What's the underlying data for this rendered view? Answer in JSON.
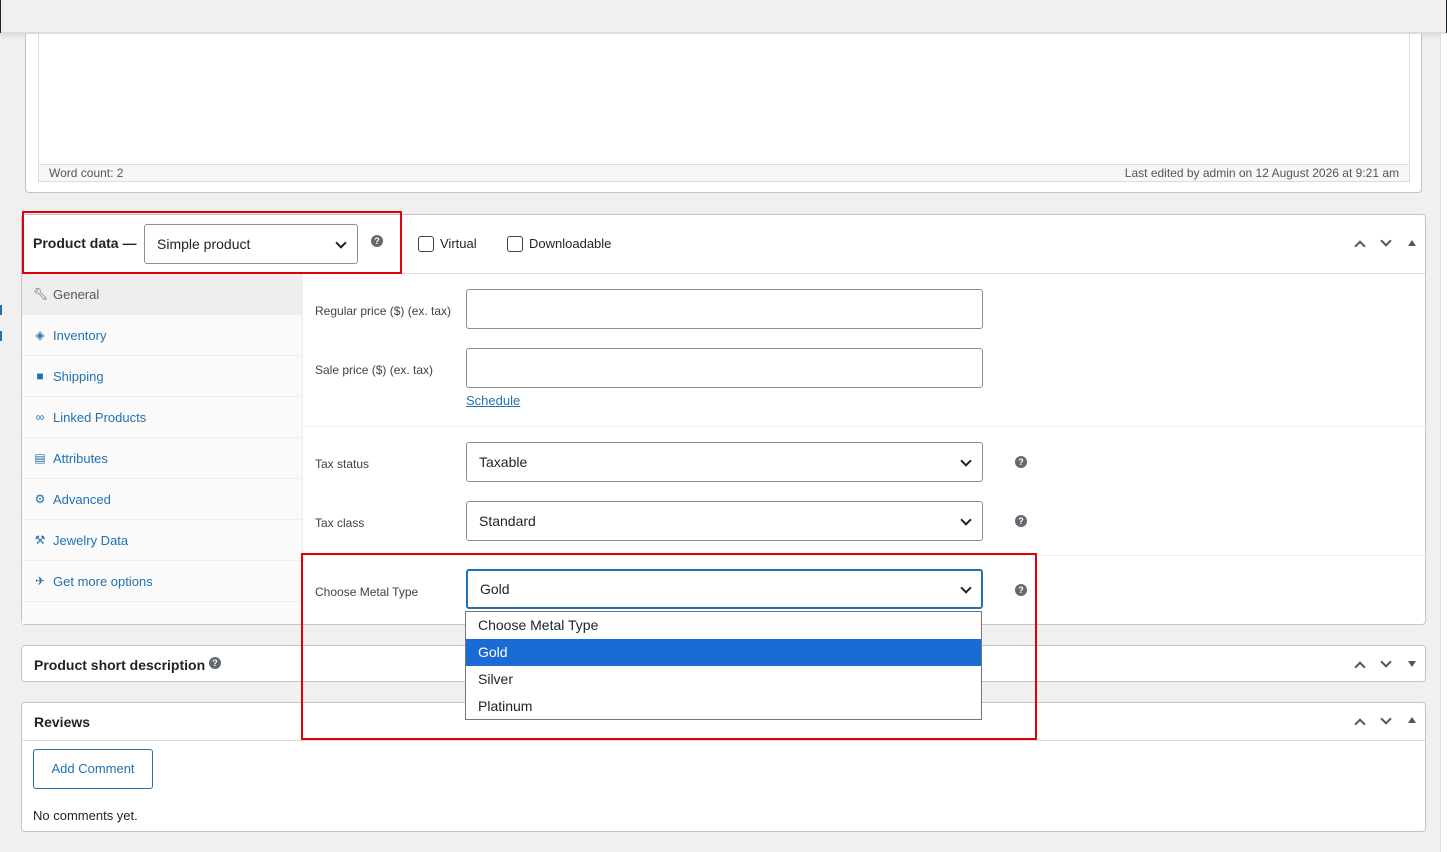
{
  "editor": {
    "word_count": "Word count: 2",
    "last_edited": "Last edited by admin on 12 August 2026 at 9:21 am"
  },
  "product_data": {
    "title": "Product data —",
    "type_selected": "Simple product",
    "virtual_label": "Virtual",
    "downloadable_label": "Downloadable",
    "tabs": [
      {
        "label": "General",
        "icon": "wrench-icon"
      },
      {
        "label": "Inventory",
        "icon": "tag-icon"
      },
      {
        "label": "Shipping",
        "icon": "truck-icon"
      },
      {
        "label": "Linked Products",
        "icon": "link-icon"
      },
      {
        "label": "Attributes",
        "icon": "list-icon"
      },
      {
        "label": "Advanced",
        "icon": "gear-icon"
      },
      {
        "label": "Jewelry Data",
        "icon": "wrench-icon"
      },
      {
        "label": "Get more options",
        "icon": "plugin-icon"
      }
    ],
    "general": {
      "regular_price_label": "Regular price ($) (ex. tax)",
      "regular_price_value": "",
      "sale_price_label": "Sale price ($) (ex. tax)",
      "sale_price_value": "",
      "schedule_link": "Schedule",
      "tax_status_label": "Tax status",
      "tax_status_value": "Taxable",
      "tax_class_label": "Tax class",
      "tax_class_value": "Standard",
      "metal_type_label": "Choose Metal Type",
      "metal_type_value": "Gold",
      "metal_type_options": [
        "Choose Metal Type",
        "Gold",
        "Silver",
        "Platinum"
      ]
    }
  },
  "short_description": {
    "title": "Product short description"
  },
  "reviews": {
    "title": "Reviews",
    "add_comment": "Add Comment",
    "empty_text": "No comments yet."
  },
  "colors": {
    "accent": "#2271b1",
    "highlight_box": "#e0000b",
    "dropdown_selected": "#1a6cd4"
  }
}
